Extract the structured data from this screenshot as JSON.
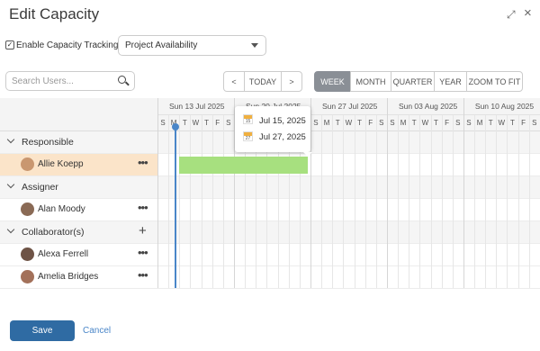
{
  "title": "Edit Capacity",
  "icons": {
    "expand": "expand-icon",
    "close": "close-icon"
  },
  "tracking": {
    "checked": true,
    "label": "Enable Capacity Tracking"
  },
  "availability": {
    "selected": "Project Availability"
  },
  "search": {
    "placeholder": "Search Users..."
  },
  "nav": {
    "prev": "<",
    "today": "TODAY",
    "next": ">"
  },
  "views": [
    {
      "label": "WEEK",
      "active": true
    },
    {
      "label": "MONTH",
      "active": false
    },
    {
      "label": "QUARTER",
      "active": false
    },
    {
      "label": "YEAR",
      "active": false
    },
    {
      "label": "ZOOM TO FIT",
      "active": false
    }
  ],
  "timeline": {
    "weeks": [
      "Sun 13 Jul 2025",
      "Sun 20 Jul 2025",
      "Sun 27 Jul 2025",
      "Sun 03 Aug 2025",
      "Sun 10 Aug 2025"
    ],
    "days": [
      "S",
      "M",
      "T",
      "W",
      "T",
      "F",
      "S",
      "S",
      "M",
      "T",
      "W",
      "T",
      "F",
      "S",
      "S",
      "M",
      "T",
      "W",
      "T",
      "F",
      "S",
      "S",
      "M",
      "T",
      "W",
      "T",
      "F",
      "S",
      "S",
      "M",
      "T",
      "W",
      "T",
      "F",
      "S"
    ]
  },
  "rows": [
    {
      "type": "group",
      "label": "Responsible"
    },
    {
      "type": "user",
      "name": "Allie Koepp",
      "selected": true,
      "avatar_color": "#c99770"
    },
    {
      "type": "group",
      "label": "Assigner"
    },
    {
      "type": "user",
      "name": "Alan Moody",
      "selected": false,
      "avatar_color": "#8a6a55"
    },
    {
      "type": "group",
      "label": "Collaborator(s)",
      "add": "+"
    },
    {
      "type": "user",
      "name": "Alexa Ferrell",
      "selected": false,
      "avatar_color": "#6e5346"
    },
    {
      "type": "user",
      "name": "Amelia Bridges",
      "selected": false,
      "avatar_color": "#a3715a"
    }
  ],
  "allocation": {
    "start": "Jul 15, 2025",
    "end": "Jul 27, 2025",
    "color": "#a7e07f"
  },
  "tooltip": {
    "start_day": "15",
    "start": "Jul 15, 2025",
    "end_day": "27",
    "end": "Jul 27, 2025"
  },
  "footer": {
    "save": "Save",
    "cancel": "Cancel"
  }
}
